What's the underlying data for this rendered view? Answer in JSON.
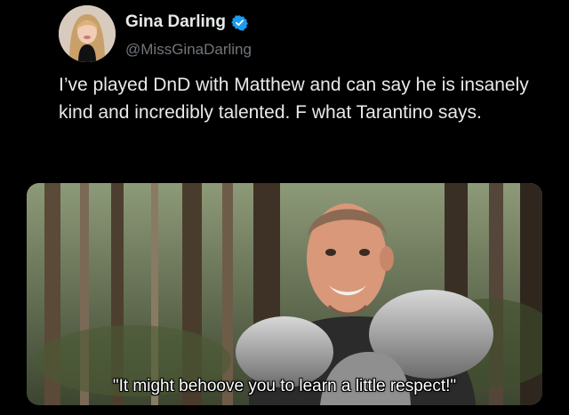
{
  "user": {
    "display_name": "Gina Darling",
    "handle": "@MissGinaDarling",
    "verified_icon": "verified-badge-icon",
    "verified_color": "#1d9bf0"
  },
  "tweet": {
    "text": "I’ve played DnD with Matthew and can say he is insanely kind and incredibly talented. F what Tarantino says."
  },
  "media": {
    "subtitle": "\"It might behoove you to learn a little respect!\""
  },
  "colors": {
    "background": "#000000",
    "text": "#e7e9ea",
    "secondary_text": "#71767b"
  }
}
